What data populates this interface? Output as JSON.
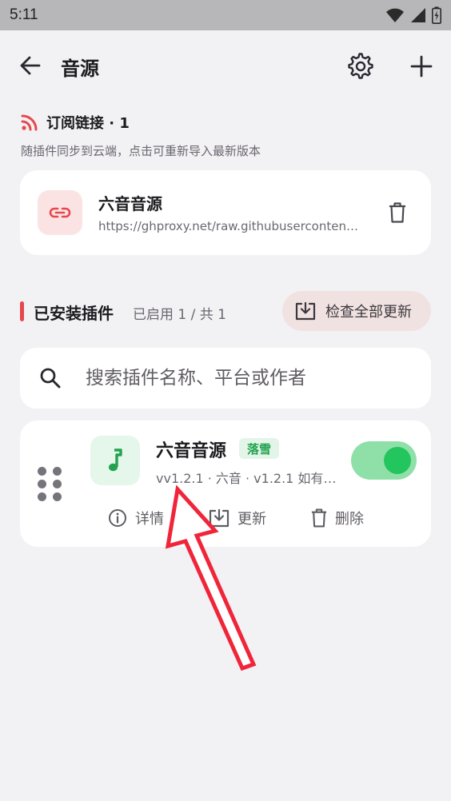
{
  "status_bar": {
    "time": "5:11"
  },
  "app_bar": {
    "title": "音源"
  },
  "subscription": {
    "title": "订阅链接 · 1",
    "description": "随插件同步到云端，点击可重新导入最新版本",
    "item": {
      "name": "六音音源",
      "url": "https://ghproxy.net/raw.githubusercontent.com"
    }
  },
  "installed": {
    "title": "已安装插件",
    "count": "已启用 1 / 共 1",
    "check_updates_label": "检查全部更新",
    "search_placeholder": "搜索插件名称、平台或作者",
    "plugin": {
      "name": "六音音源",
      "badge": "落雪",
      "meta": "vv1.2.1 · 六音 · v1.2.1 如有问题",
      "enabled": true,
      "actions": {
        "detail": "详情",
        "update": "更新",
        "delete": "删除"
      }
    }
  },
  "colors": {
    "accent_red": "#e5484d",
    "accent_green": "#22c55e",
    "annotation_arrow": "#f0253a"
  }
}
